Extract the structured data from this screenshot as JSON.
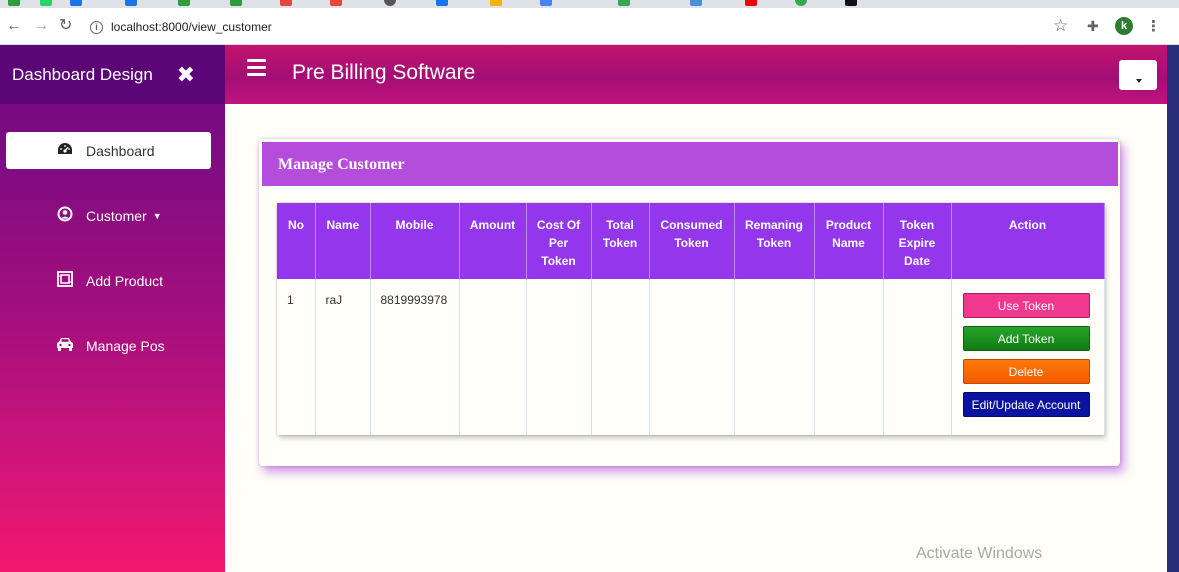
{
  "browser": {
    "url": "localhost:8000/view_customer",
    "avatar_letter": "k"
  },
  "sidebar": {
    "title": "Dashboard Design",
    "close_glyph": "✖",
    "items": [
      {
        "label": "Dashboard",
        "icon": "dashboard-icon",
        "active": true
      },
      {
        "label": "Customer",
        "icon": "user-circle-icon",
        "has_caret": true
      },
      {
        "label": "Add Product",
        "icon": "product-box-icon"
      },
      {
        "label": "Manage Pos",
        "icon": "car-icon"
      }
    ],
    "gradient": [
      "#6d087f",
      "#f2176d"
    ]
  },
  "header": {
    "app_title": "Pre Billing Software",
    "color": "#a40e75"
  },
  "card": {
    "title": "Manage Customer",
    "header_color": "#b54ddc"
  },
  "table": {
    "header_color": "#9336ec",
    "columns": [
      "No",
      "Name",
      "Mobile",
      "Amount",
      "Cost Of Per Token",
      "Total Token",
      "Consumed Token",
      "Remaning Token",
      "Product Name",
      "Token Expire Date",
      "Action"
    ],
    "rows": [
      {
        "no": "1",
        "name": "raJ",
        "mobile": "8819993978",
        "amount": "",
        "cost_per_token": "",
        "total_token": "",
        "consumed_token": "",
        "remaining_token": "",
        "product_name": "",
        "token_expire_date": ""
      }
    ],
    "actions": {
      "use_token": "Use Token",
      "add_token": "Add Token",
      "delete": "Delete",
      "edit": "Edit/Update Account"
    }
  },
  "watermark": "Activate Windows"
}
